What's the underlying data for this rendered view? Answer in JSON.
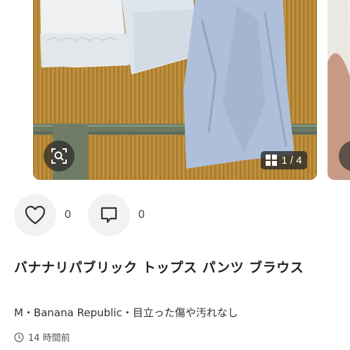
{
  "item": {
    "image_counter": "1 / 4",
    "like_count": "0",
    "comment_count": "0",
    "title": "バナナリパブリック トップス パンツ ブラウス",
    "meta": "M・Banana Republic・目立った傷や汚れなし",
    "posted_time": "14 時間前"
  },
  "icons": {
    "zoom": "zoom-search-icon",
    "gallery": "grid-icon",
    "like": "heart-icon",
    "comment": "comment-icon",
    "time": "clock-icon"
  },
  "colors": {
    "action_bg": "#f2f2f2",
    "overlay": "#282828",
    "text_primary": "#222222",
    "text_secondary": "#555555"
  }
}
